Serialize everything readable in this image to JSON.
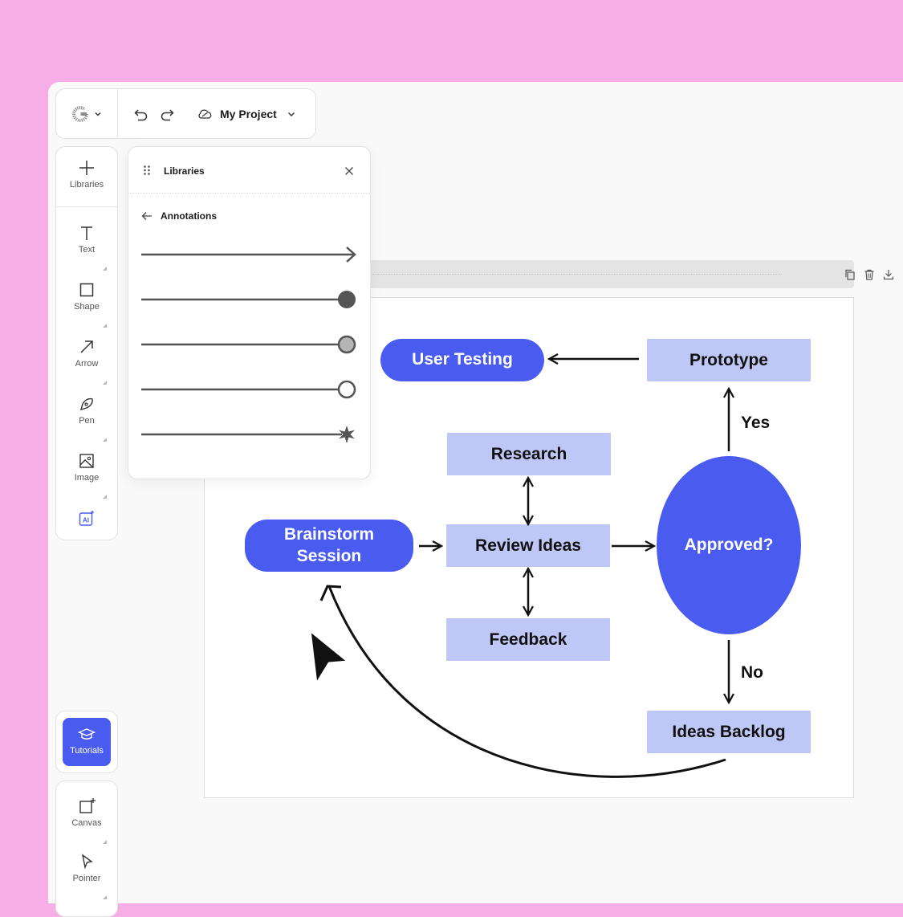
{
  "toolbar": {
    "project_name": "My Project",
    "logo_icon": "brand-g-logo",
    "undo_icon": "undo-icon",
    "redo_icon": "redo-icon",
    "cloud_icon": "cloud-sync-icon"
  },
  "tools": {
    "libraries": "Libraries",
    "text": "Text",
    "shape": "Shape",
    "arrow": "Arrow",
    "pen": "Pen",
    "image": "Image",
    "ai_icon": "ai-icon"
  },
  "tutorials": {
    "label": "Tutorials"
  },
  "bottom_tools": {
    "canvas": "Canvas",
    "pointer": "Pointer"
  },
  "libraries_panel": {
    "title": "Libraries",
    "section": "Annotations",
    "items": [
      "arrow-end",
      "filled-circle-end",
      "gray-circle-end",
      "hollow-circle-end",
      "star-end"
    ]
  },
  "diagram": {
    "nodes": {
      "user_testing": "User Testing",
      "prototype": "Prototype",
      "research": "Research",
      "brainstorm_line1": "Brainstorm",
      "brainstorm_line2": "Session",
      "review_ideas": "Review Ideas",
      "approved": "Approved?",
      "feedback": "Feedback",
      "ideas_backlog": "Ideas Backlog"
    },
    "labels": {
      "yes": "Yes",
      "no": "No"
    }
  },
  "colors": {
    "accent": "#4a5cf0",
    "node_fill": "#bec7f5",
    "background": "#f7aee7"
  }
}
